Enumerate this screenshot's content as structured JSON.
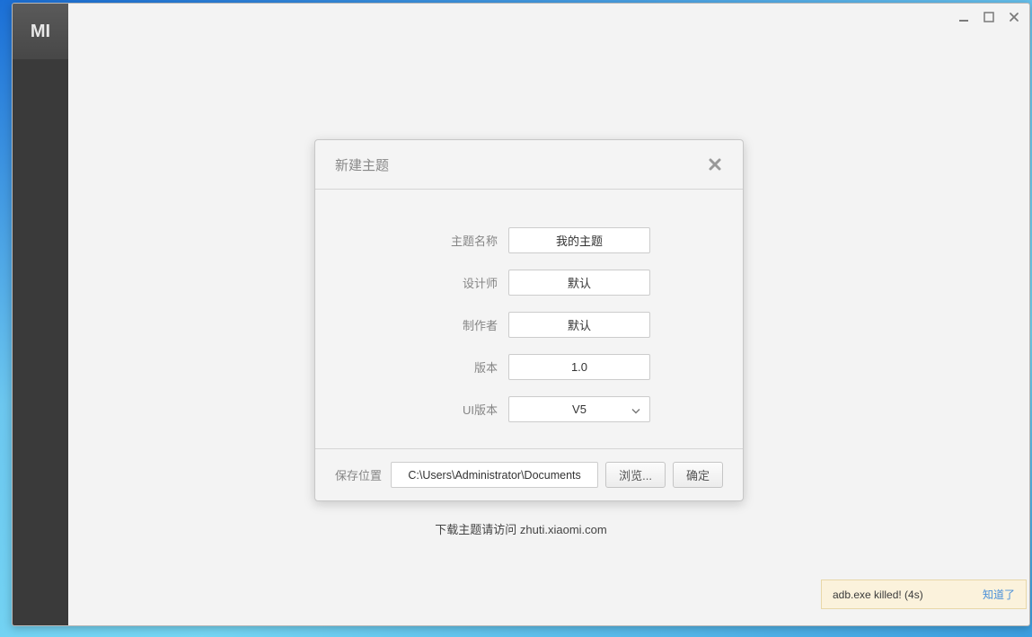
{
  "app": {
    "logo": "MI"
  },
  "dialog": {
    "title": "新建主题",
    "fields": {
      "theme_name": {
        "label": "主题名称",
        "value": "我的主题"
      },
      "designer": {
        "label": "设计师",
        "value": "默认"
      },
      "author": {
        "label": "制作者",
        "value": "默认"
      },
      "version": {
        "label": "版本",
        "value": "1.0"
      },
      "ui_version": {
        "label": "UI版本",
        "value": "V5"
      }
    },
    "save": {
      "label": "保存位置",
      "path": "C:\\Users\\Administrator\\Documents",
      "browse": "浏览...",
      "confirm": "确定"
    }
  },
  "hint": "下载主题请访问 zhuti.xiaomi.com",
  "toast": {
    "message": "adb.exe killed! (4s)",
    "action": "知道了"
  }
}
